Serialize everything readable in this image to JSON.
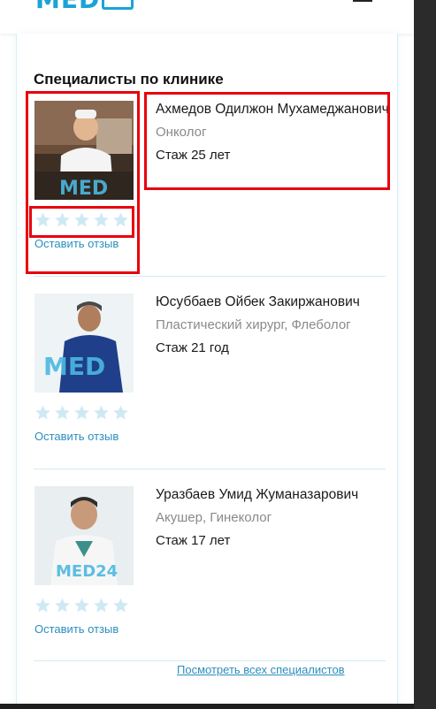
{
  "header": {
    "logo_text": "MED",
    "brand_color": "#1aa3d6"
  },
  "section": {
    "title": "Специалисты по клинике"
  },
  "doctors": [
    {
      "name": "Ахмедов Одилжон Мухамеджанович",
      "specialty": "Онколог",
      "experience": "Стаж 25 лет",
      "rating_stars": 5,
      "rating_filled": 0,
      "review_label": "Оставить отзыв",
      "photo_watermark": "MED"
    },
    {
      "name": "Юсуббаев Ойбек Закиржанович",
      "specialty": "Пластический хирург, Флеболог",
      "experience": "Стаж 21 год",
      "rating_stars": 5,
      "rating_filled": 0,
      "review_label": "Оставить отзыв",
      "photo_watermark": "MED"
    },
    {
      "name": "Уразбаев Умид Жуманазарович",
      "specialty": "Акушер, Гинеколог",
      "experience": "Стаж 17 лет",
      "rating_stars": 5,
      "rating_filled": 0,
      "review_label": "Оставить отзыв",
      "photo_watermark": "MED24"
    }
  ],
  "footer": {
    "all_link": "Посмотреть всех специалистов"
  },
  "colors": {
    "star": "#cfe9f4",
    "link": "#2a8fbd",
    "highlight": "#e8000d"
  }
}
